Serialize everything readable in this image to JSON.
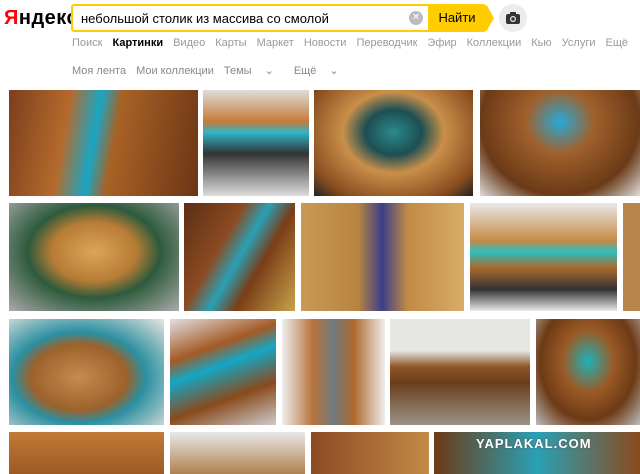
{
  "logo": {
    "text_prefix": "Я",
    "text_rest": "ндекс"
  },
  "search": {
    "value": "небольшой столик из массива со смолой",
    "find_label": "Найти"
  },
  "services": [
    "Поиск",
    "Картинки",
    "Видео",
    "Карты",
    "Маркет",
    "Новости",
    "Переводчик",
    "Эфир",
    "Коллекции",
    "Кью",
    "Услуги",
    "Ещё"
  ],
  "subnav": [
    "Моя лента",
    "Мои коллекции",
    "Темы",
    "Ещё"
  ],
  "watermark": "YAPLAKAL.COM",
  "colors": {
    "accent": "#ffcc00",
    "logo_red": "#ff0000",
    "resin_blue": "#1fa7c8",
    "wood": "#8b5a2b"
  }
}
